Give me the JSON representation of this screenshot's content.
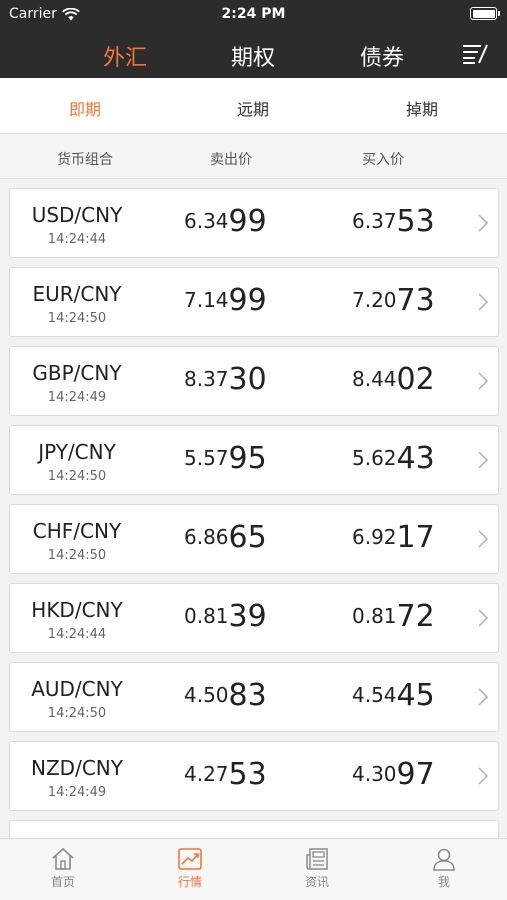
{
  "status_bar": {
    "carrier": "Carrier",
    "time": "2:24 PM"
  },
  "main_tabs": [
    {
      "label": "外汇",
      "active": true
    },
    {
      "label": "期权",
      "active": false
    },
    {
      "label": "债券",
      "active": false
    }
  ],
  "menu_icon": "sort-menu-icon",
  "sub_tabs": [
    {
      "label": "即期",
      "active": true
    },
    {
      "label": "远期",
      "active": false
    },
    {
      "label": "掉期",
      "active": false
    }
  ],
  "columns": {
    "pair": "货币组合",
    "sell": "卖出价",
    "buy": "买入价"
  },
  "rows": [
    {
      "pair": "USD/CNY",
      "time": "14:24:44",
      "sell_pre": "6.34",
      "sell_big": "99",
      "buy_pre": "6.37",
      "buy_big": "53"
    },
    {
      "pair": "EUR/CNY",
      "time": "14:24:50",
      "sell_pre": "7.14",
      "sell_big": "99",
      "buy_pre": "7.20",
      "buy_big": "73"
    },
    {
      "pair": "GBP/CNY",
      "time": "14:24:49",
      "sell_pre": "8.37",
      "sell_big": "30",
      "buy_pre": "8.44",
      "buy_big": "02"
    },
    {
      "pair": "JPY/CNY",
      "time": "14:24:50",
      "sell_pre": "5.57",
      "sell_big": "95",
      "buy_pre": "5.62",
      "buy_big": "43"
    },
    {
      "pair": "CHF/CNY",
      "time": "14:24:50",
      "sell_pre": "6.86",
      "sell_big": "65",
      "buy_pre": "6.92",
      "buy_big": "17"
    },
    {
      "pair": "HKD/CNY",
      "time": "14:24:44",
      "sell_pre": "0.81",
      "sell_big": "39",
      "buy_pre": "0.81",
      "buy_big": "72"
    },
    {
      "pair": "AUD/CNY",
      "time": "14:24:50",
      "sell_pre": "4.50",
      "sell_big": "83",
      "buy_pre": "4.54",
      "buy_big": "45"
    },
    {
      "pair": "NZD/CNY",
      "time": "14:24:49",
      "sell_pre": "4.27",
      "sell_big": "53",
      "buy_pre": "4.30",
      "buy_big": "97"
    }
  ],
  "tab_bar": [
    {
      "label": "首页",
      "icon": "home-icon",
      "active": false
    },
    {
      "label": "行情",
      "icon": "market-chart-icon",
      "active": true
    },
    {
      "label": "资讯",
      "icon": "news-icon",
      "active": false
    },
    {
      "label": "我",
      "icon": "profile-icon",
      "active": false
    }
  ],
  "colors": {
    "accent": "#f0763a",
    "header_bg": "#2c2c2c"
  }
}
